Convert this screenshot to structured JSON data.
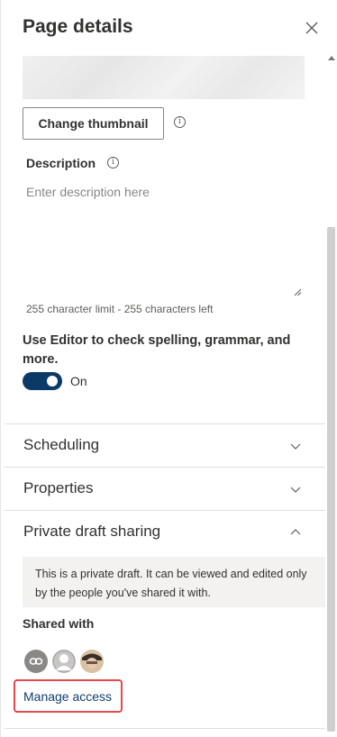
{
  "header": {
    "title": "Page details",
    "close_icon": "close-icon"
  },
  "thumbnail": {
    "change_button_label": "Change thumbnail",
    "info_icon": "info-icon"
  },
  "description": {
    "label": "Description",
    "placeholder": "Enter description here",
    "value": "",
    "char_limit_text": "255 character limit - 255 characters left"
  },
  "editor": {
    "text": "Use Editor to check spelling, grammar, and more.",
    "toggle_on": true,
    "toggle_label": "On"
  },
  "sections": {
    "scheduling": "Scheduling",
    "properties": "Properties",
    "private_draft": "Private draft sharing"
  },
  "private_draft": {
    "note": "This is a private draft. It can be viewed and edited only by the people you've shared it with.",
    "shared_with_label": "Shared with",
    "manage_access_label": "Manage access"
  },
  "colors": {
    "toggle_on": "#0b3a67",
    "link": "#0f3e6c",
    "highlight": "#e5484d",
    "note_bg": "#f3f2f1"
  }
}
